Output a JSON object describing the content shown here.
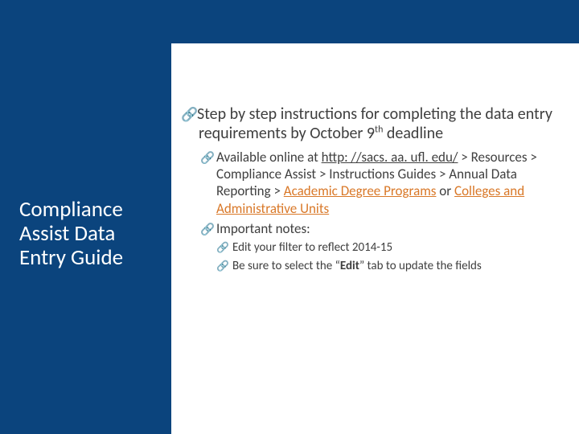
{
  "title": "Compliance Assist Data Entry Guide",
  "main": {
    "step_text_a": "Step by step instructions for completing the data entry requirements by October 9",
    "step_text_b": " deadline",
    "sup_th": "th",
    "avail_a": "Available online at ",
    "avail_link": "http: //sacs. aa. ufl. edu/",
    "avail_b": " > Resources > Compliance Assist > Instructions Guides > Annual Data Reporting > ",
    "avail_link2": "Academic Degree Programs",
    "avail_c": " or ",
    "avail_link3": "Colleges and Administrative Units",
    "notes_label": "Important notes:",
    "note1": "Edit your filter to reflect 2014-15",
    "note2_a": "Be sure to select the “",
    "note2_bold": "Edit",
    "note2_b": "” tab to update the fields"
  },
  "icons": {
    "link_glyph": "🔗"
  }
}
